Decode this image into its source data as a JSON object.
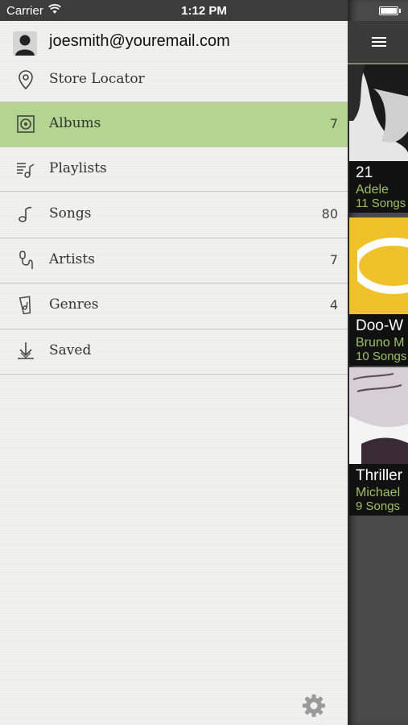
{
  "status_bar": {
    "carrier": "Carrier",
    "time": "1:12 PM"
  },
  "user": {
    "email": "joesmith@youremail.com"
  },
  "menu": [
    {
      "label": "Store Locator",
      "count": "",
      "icon": "location-pin-icon"
    },
    {
      "label": "Albums",
      "count": "7",
      "icon": "album-icon",
      "active": true
    },
    {
      "label": "Playlists",
      "count": "",
      "icon": "playlist-icon"
    },
    {
      "label": "Songs",
      "count": "80",
      "icon": "music-note-icon"
    },
    {
      "label": "Artists",
      "count": "7",
      "icon": "artist-microphone-icon"
    },
    {
      "label": "Genres",
      "count": "4",
      "icon": "genre-tag-icon"
    },
    {
      "label": "Saved",
      "count": "",
      "icon": "download-icon"
    }
  ],
  "albums": [
    {
      "title": "21",
      "artist": "Adele",
      "songs": "11 Songs"
    },
    {
      "title": "Doo-W",
      "artist": "Bruno M",
      "songs": "10 Songs"
    },
    {
      "title": "Thriller",
      "artist": "Michael",
      "songs": "9 Songs"
    }
  ],
  "colors": {
    "accent_active": "#b3d58f",
    "artist_text": "#9ec05f"
  }
}
